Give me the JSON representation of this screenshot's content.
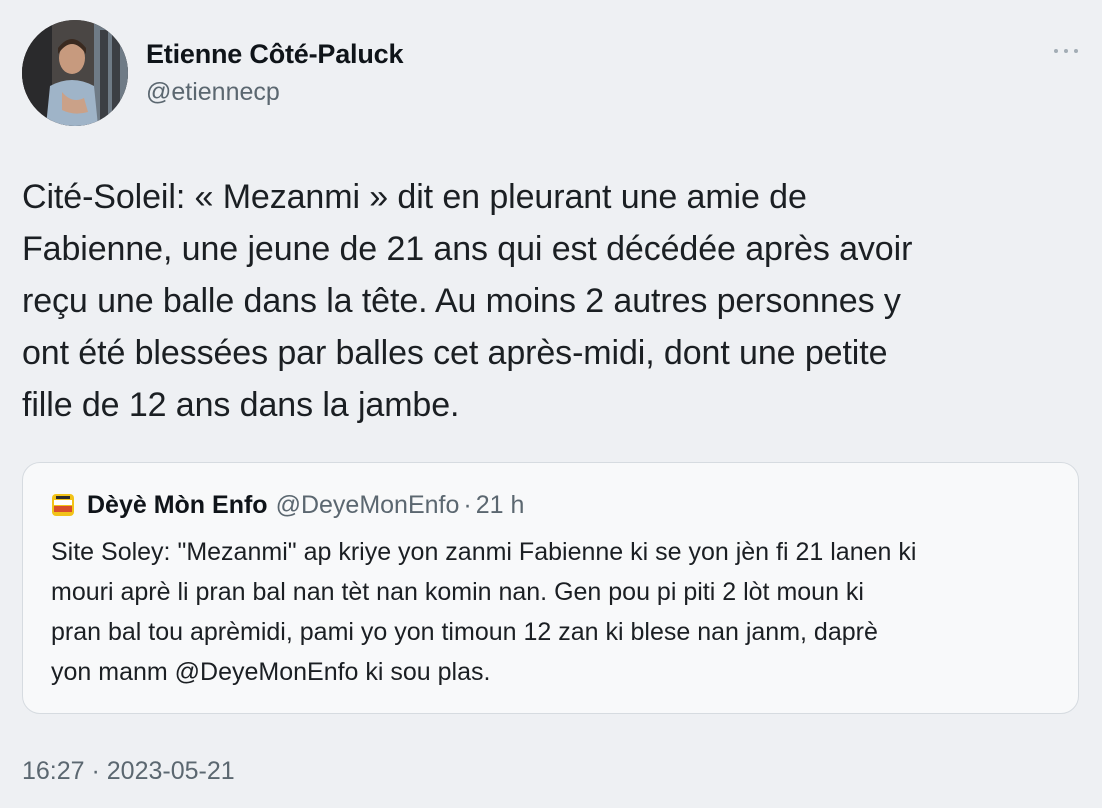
{
  "author": {
    "name": "Etienne Côté-Paluck",
    "handle": "@etiennecp"
  },
  "tweet": {
    "lines": [
      "Cité-Soleil: « Mezanmi » dit en pleurant une amie de",
      "Fabienne, une jeune de 21 ans qui est décédée après avoir",
      "reçu une balle dans la tête. Au moins 2 autres personnes y",
      "ont été blessées par balles cet après-midi, dont une petite",
      "fille de 12 ans dans la jambe."
    ]
  },
  "quote": {
    "logo_text": "DÈYÈ ENFO",
    "name": "Dèyè Mòn Enfo",
    "handle": "@DeyeMonEnfo",
    "separator": "·",
    "time": "21 h",
    "lines": [
      "Site Soley: \"Mezanmi\" ap kriye yon zanmi Fabienne ki se yon jèn fi 21 lanen ki",
      "mouri aprè li pran bal nan tèt nan komin nan. Gen pou pi piti 2 lòt moun ki",
      "pran bal tou aprèmidi, pami yo yon timoun 12 zan ki blese nan janm, daprè",
      "yon manm @DeyeMonEnfo ki sou plas."
    ]
  },
  "timestamp": "16:27 · 2023-05-21",
  "icons": {
    "more": "more-horizontal-icon"
  },
  "colors": {
    "background": "#eef0f3",
    "secondary_text": "#5b6770",
    "card_border": "#d6dbe0"
  }
}
